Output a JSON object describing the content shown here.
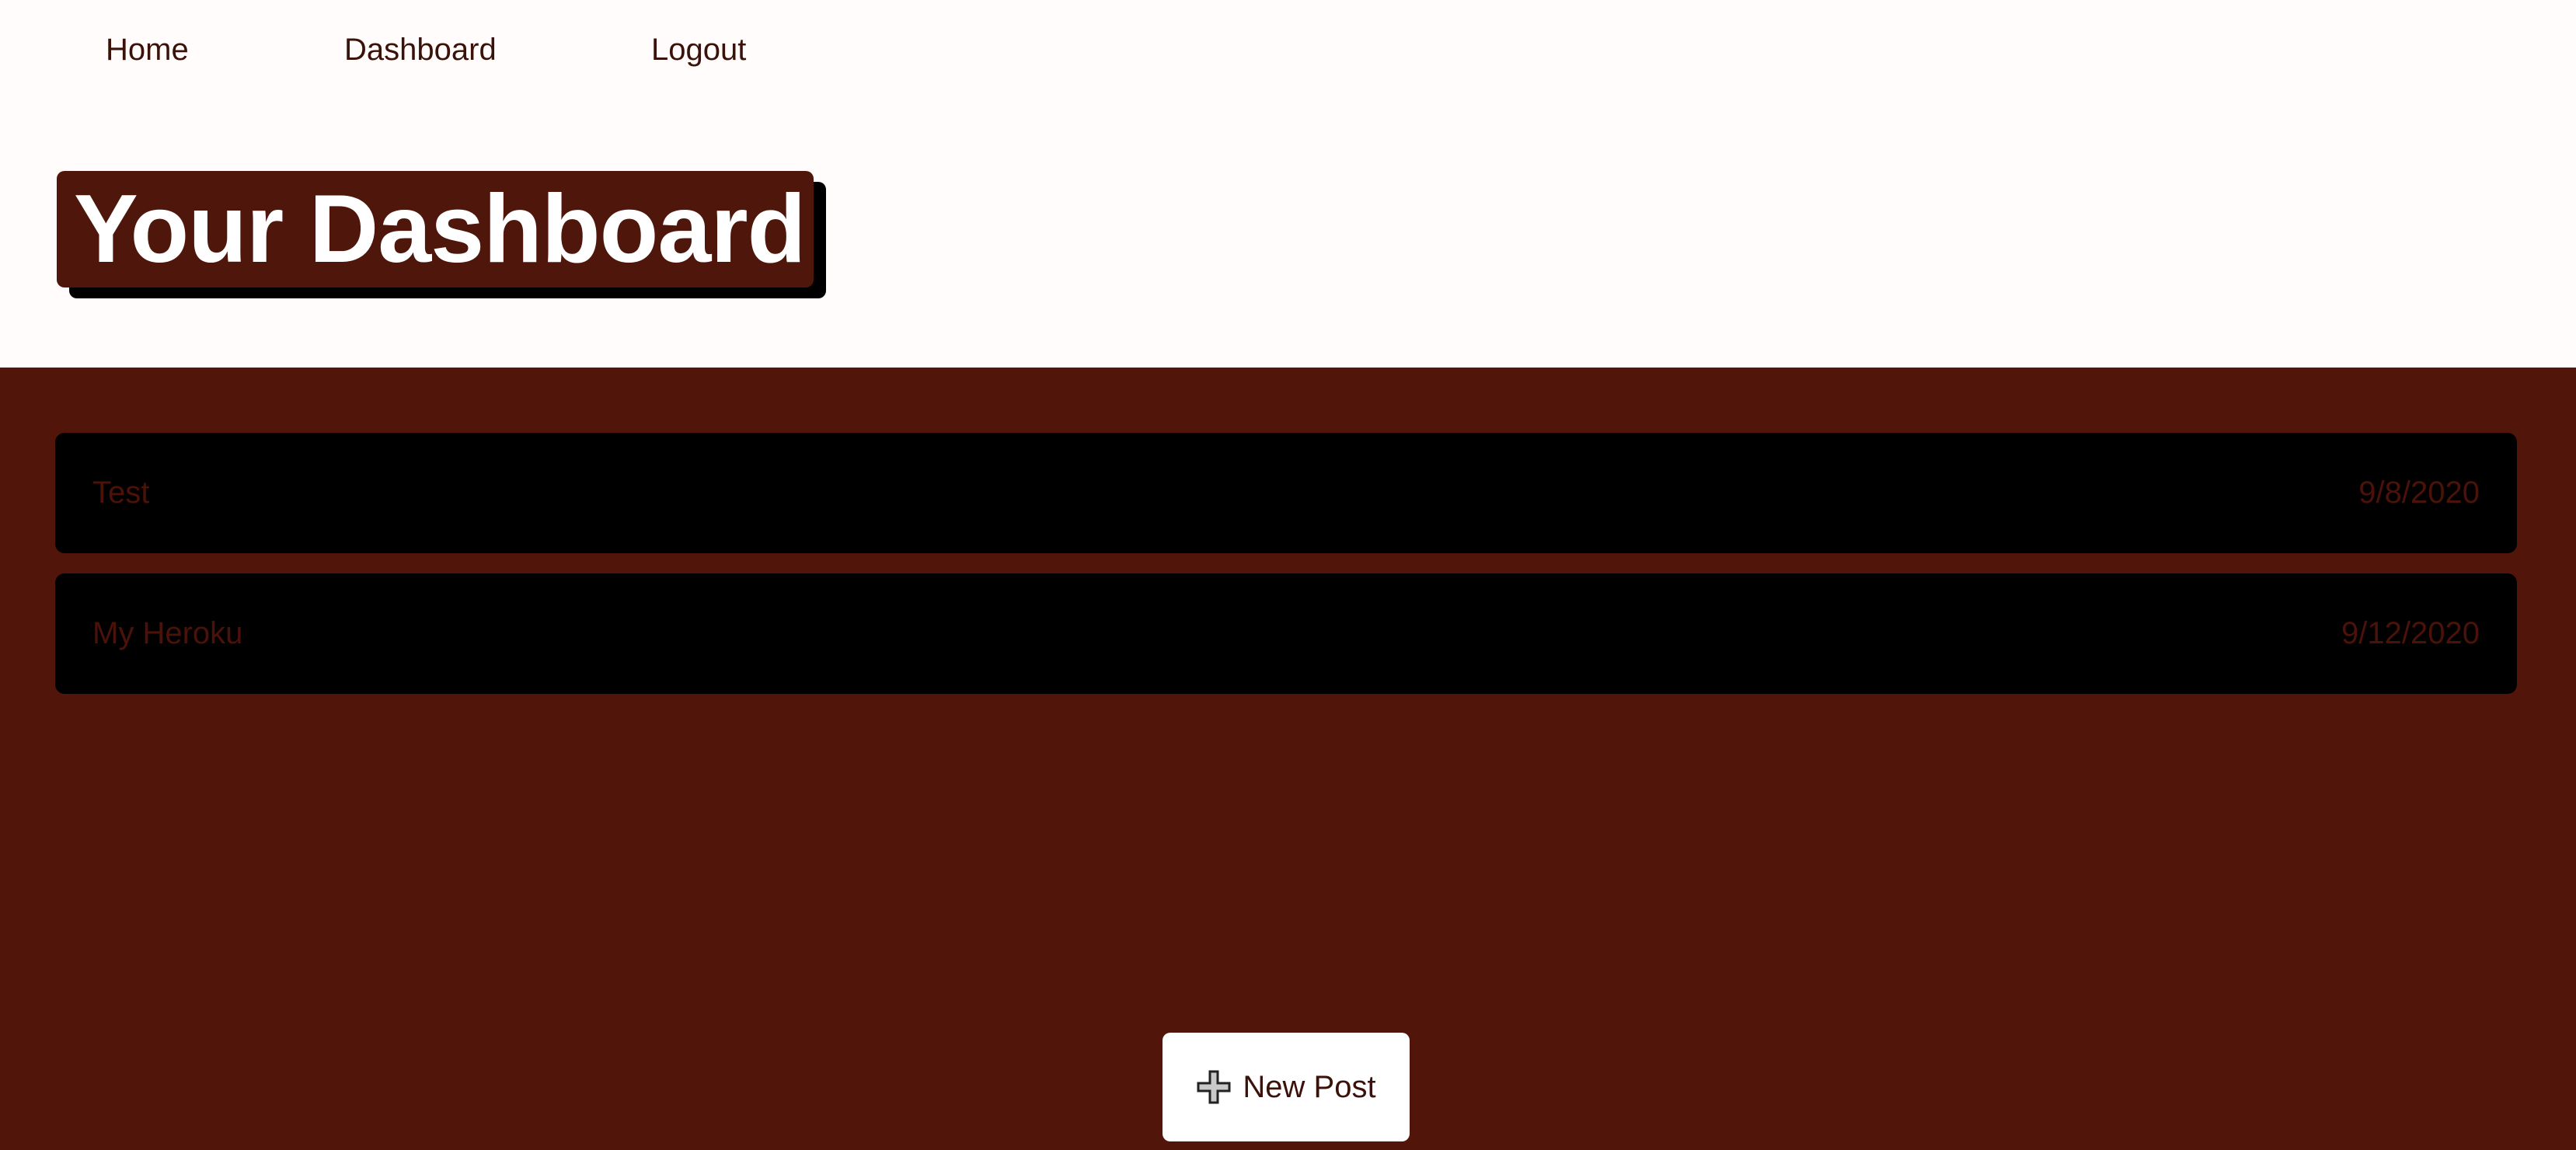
{
  "nav": {
    "home": "Home",
    "dashboard": "Dashboard",
    "logout": "Logout"
  },
  "page": {
    "title": "Your Dashboard"
  },
  "posts": [
    {
      "title": "Test",
      "date": "9/8/2020"
    },
    {
      "title": "My Heroku",
      "date": "9/12/2020"
    }
  ],
  "actions": {
    "new_post_label": "New Post",
    "new_post_icon": "plus-icon"
  },
  "colors": {
    "brand": "#511609",
    "title_bg": "#4f170c",
    "card_bg": "#000000"
  }
}
